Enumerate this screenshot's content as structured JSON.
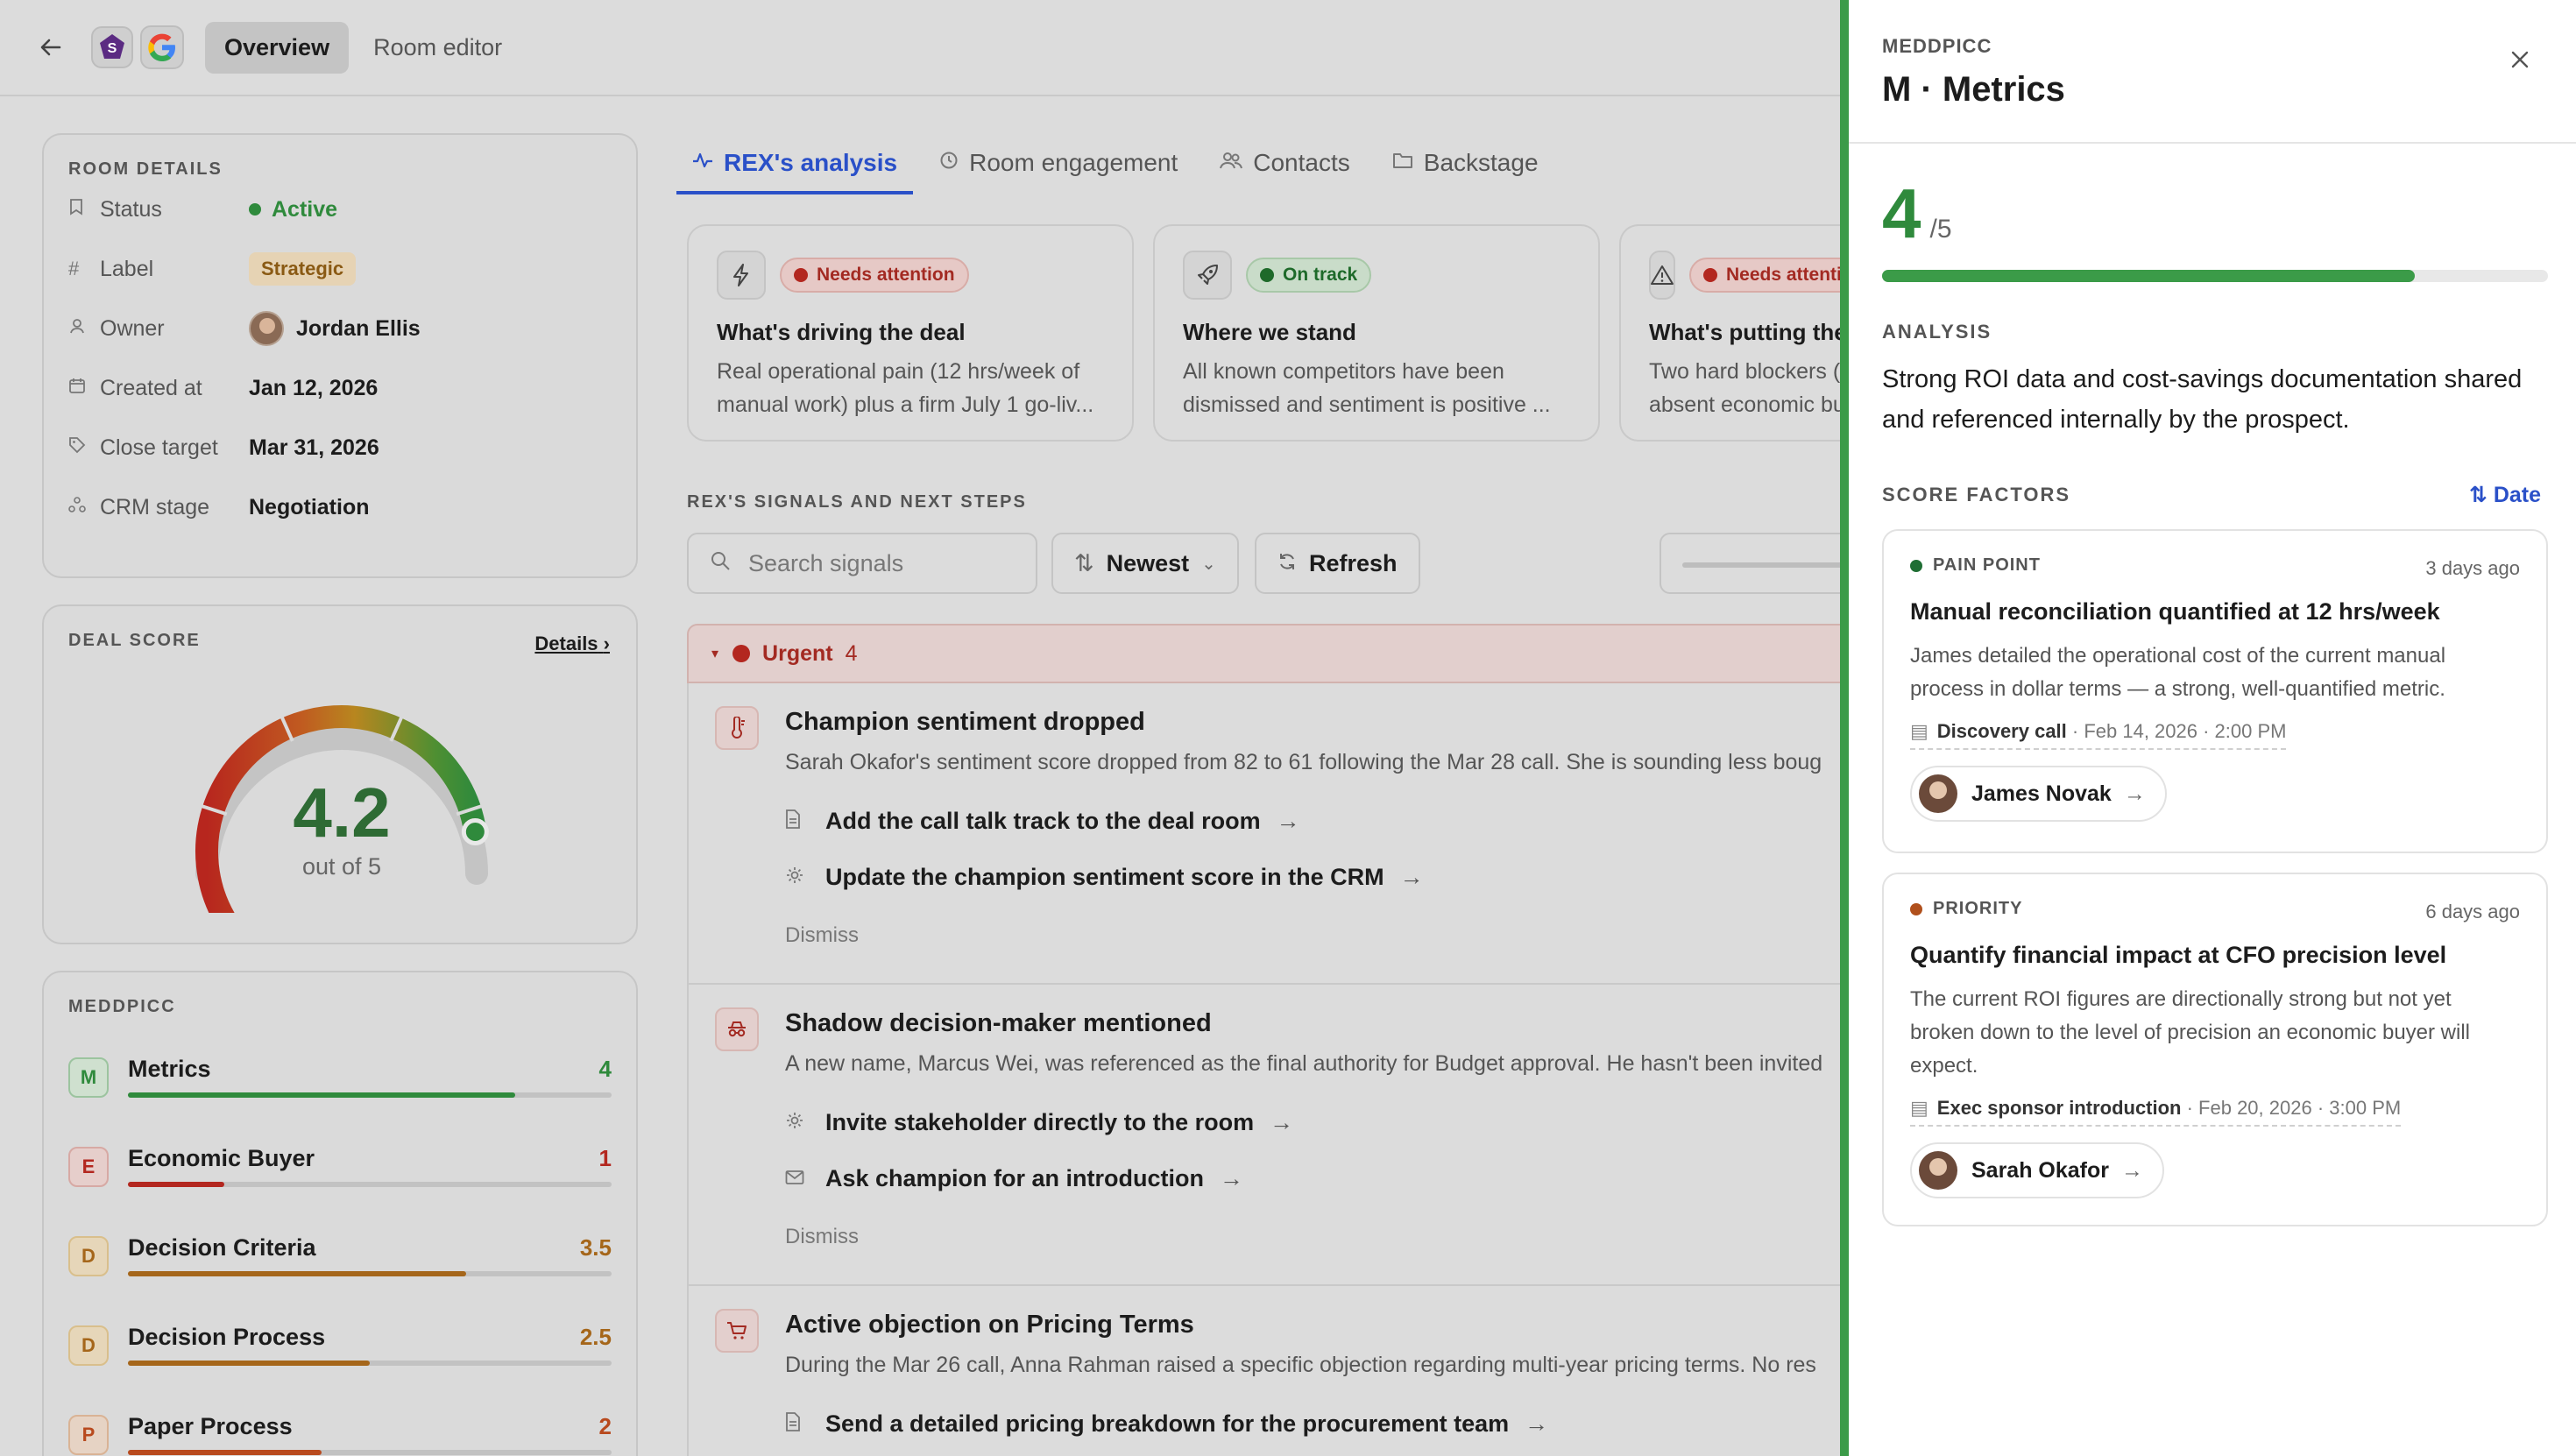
{
  "topbar": {
    "tabs": [
      {
        "label": "Overview",
        "active": true
      },
      {
        "label": "Room editor",
        "active": false
      }
    ]
  },
  "room_details": {
    "title": "ROOM DETAILS",
    "rows": [
      {
        "label": "Status",
        "value": "Active",
        "icon": "bookmark-icon"
      },
      {
        "label": "Label",
        "value": "Strategic",
        "icon": "hash-icon"
      },
      {
        "label": "Owner",
        "value": "Jordan Ellis",
        "icon": "user-icon"
      },
      {
        "label": "Created at",
        "value": "Jan 12, 2026",
        "icon": "calendar-icon"
      },
      {
        "label": "Close target",
        "value": "Mar 31, 2026",
        "icon": "tag-icon"
      },
      {
        "label": "CRM stage",
        "value": "Negotiation",
        "icon": "flow-icon"
      }
    ]
  },
  "deal_score": {
    "title": "DEAL SCORE",
    "details_label": "Details",
    "score": "4.2",
    "score_value": 4.2,
    "score_max": 5,
    "subtitle": "out of 5"
  },
  "meddpicc": {
    "title": "MEDDPICC",
    "items": [
      {
        "letter": "M",
        "name": "Metrics",
        "value": "4",
        "fraction": 0.8,
        "color": "#2f8a3c",
        "bg": "#cfe0cf",
        "border": "#9cc49f"
      },
      {
        "letter": "E",
        "name": "Economic Buyer",
        "value": "1",
        "fraction": 0.2,
        "color": "#b3271f",
        "bg": "#e6cecb",
        "border": "#d7a9a4"
      },
      {
        "letter": "D",
        "name": "Decision Criteria",
        "value": "3.5",
        "fraction": 0.7,
        "color": "#a5661a",
        "bg": "#e6d6b9",
        "border": "#d9bf8c"
      },
      {
        "letter": "D",
        "name": "Decision Process",
        "value": "2.5",
        "fraction": 0.5,
        "color": "#a5661a",
        "bg": "#e6d6b9",
        "border": "#d9bf8c"
      },
      {
        "letter": "P",
        "name": "Paper Process",
        "value": "2",
        "fraction": 0.4,
        "color": "#b84a1e",
        "bg": "#e6d3c4",
        "border": "#d9b395"
      }
    ]
  },
  "center_tabs": [
    {
      "label": "REX's analysis",
      "icon": "pulse-icon",
      "active": true
    },
    {
      "label": "Room engagement",
      "icon": "clock-icon",
      "active": false
    },
    {
      "label": "Contacts",
      "icon": "people-icon",
      "active": false
    },
    {
      "label": "Backstage",
      "icon": "folder-icon",
      "active": false
    }
  ],
  "insights": [
    {
      "icon": "bolt-icon",
      "status": "Needs attention",
      "tone": "warn",
      "title": "What's driving the deal",
      "text_1": "Real operational pain (12 hrs/week of",
      "text_2": "manual work) plus a firm July 1 go-liv..."
    },
    {
      "icon": "rocket-icon",
      "status": "On track",
      "tone": "ok",
      "title": "Where we stand",
      "text_1": "All known competitors have been",
      "text_2": "dismissed and sentiment is positive ..."
    },
    {
      "icon": "warning-icon",
      "status": "Needs attention",
      "tone": "warn",
      "title": "What's putting the deal at risk",
      "text_1": "Two hard blockers (",
      "text_2": "absent economic bu"
    }
  ],
  "signals": {
    "heading": "REX'S SIGNALS AND NEXT STEPS",
    "search_placeholder": "Search signals",
    "sort_label": "Newest",
    "refresh_label": "Refresh",
    "urgent_label": "Urgent",
    "urgent_count": "4",
    "items": [
      {
        "icon": "thermometer-icon",
        "title": "Champion sentiment dropped",
        "text": "Sarah Okafor's sentiment score dropped from 82 to 61 following the Mar 28 call. She is sounding less boug",
        "actions": [
          {
            "icon": "document-icon",
            "label": "Add the call talk track to the deal room"
          },
          {
            "icon": "gear-icon",
            "label": "Update the champion sentiment score in the CRM"
          }
        ],
        "dismiss": "Dismiss"
      },
      {
        "icon": "incognito-icon",
        "title": "Shadow decision-maker mentioned",
        "text": "A new name, Marcus Wei, was referenced as the final authority for Budget approval. He hasn't been invited",
        "actions": [
          {
            "icon": "gear-icon",
            "label": "Invite stakeholder directly to the room"
          },
          {
            "icon": "mail-icon",
            "label": "Ask champion for an introduction"
          }
        ],
        "dismiss": "Dismiss"
      },
      {
        "icon": "cart-icon",
        "title": "Active objection on Pricing Terms",
        "text": "During the Mar 26 call, Anna Rahman raised a specific objection regarding multi-year pricing terms. No res",
        "actions": [
          {
            "icon": "document-icon",
            "label": "Send a detailed pricing breakdown for the procurement team"
          }
        ],
        "dismiss": ""
      }
    ]
  },
  "panel": {
    "kicker": "MEDDPICC",
    "title": "M · Metrics",
    "score": "4",
    "score_of": "/5",
    "score_fraction": 0.8,
    "analysis_heading": "ANALYSIS",
    "analysis_text": "Strong ROI data and cost-savings documentation shared and referenced internally by the prospect.",
    "factors_heading": "SCORE FACTORS",
    "sort_label": "Date",
    "factors": [
      {
        "kicker": "PAIN POINT",
        "dot_color": "#1f6e34",
        "time": "3 days ago",
        "title": "Manual reconciliation quantified at 12 hrs/week",
        "text": "James detailed the operational cost of the current manual process in dollar terms — a strong, well-quantified metric.",
        "source": "Discovery call",
        "source_meta": " · Feb 14, 2026 · 2:00 PM",
        "person": "James Novak"
      },
      {
        "kicker": "PRIORITY",
        "dot_color": "#b0501c",
        "time": "6 days ago",
        "title": "Quantify financial impact at CFO precision level",
        "text": "The current ROI figures are directionally strong but not yet broken down to the level of precision an economic buyer will expect.",
        "source": "Exec sponsor introduction",
        "source_meta": " · Feb 20, 2026 · 3:00 PM",
        "person": "Sarah Okafor"
      }
    ]
  }
}
